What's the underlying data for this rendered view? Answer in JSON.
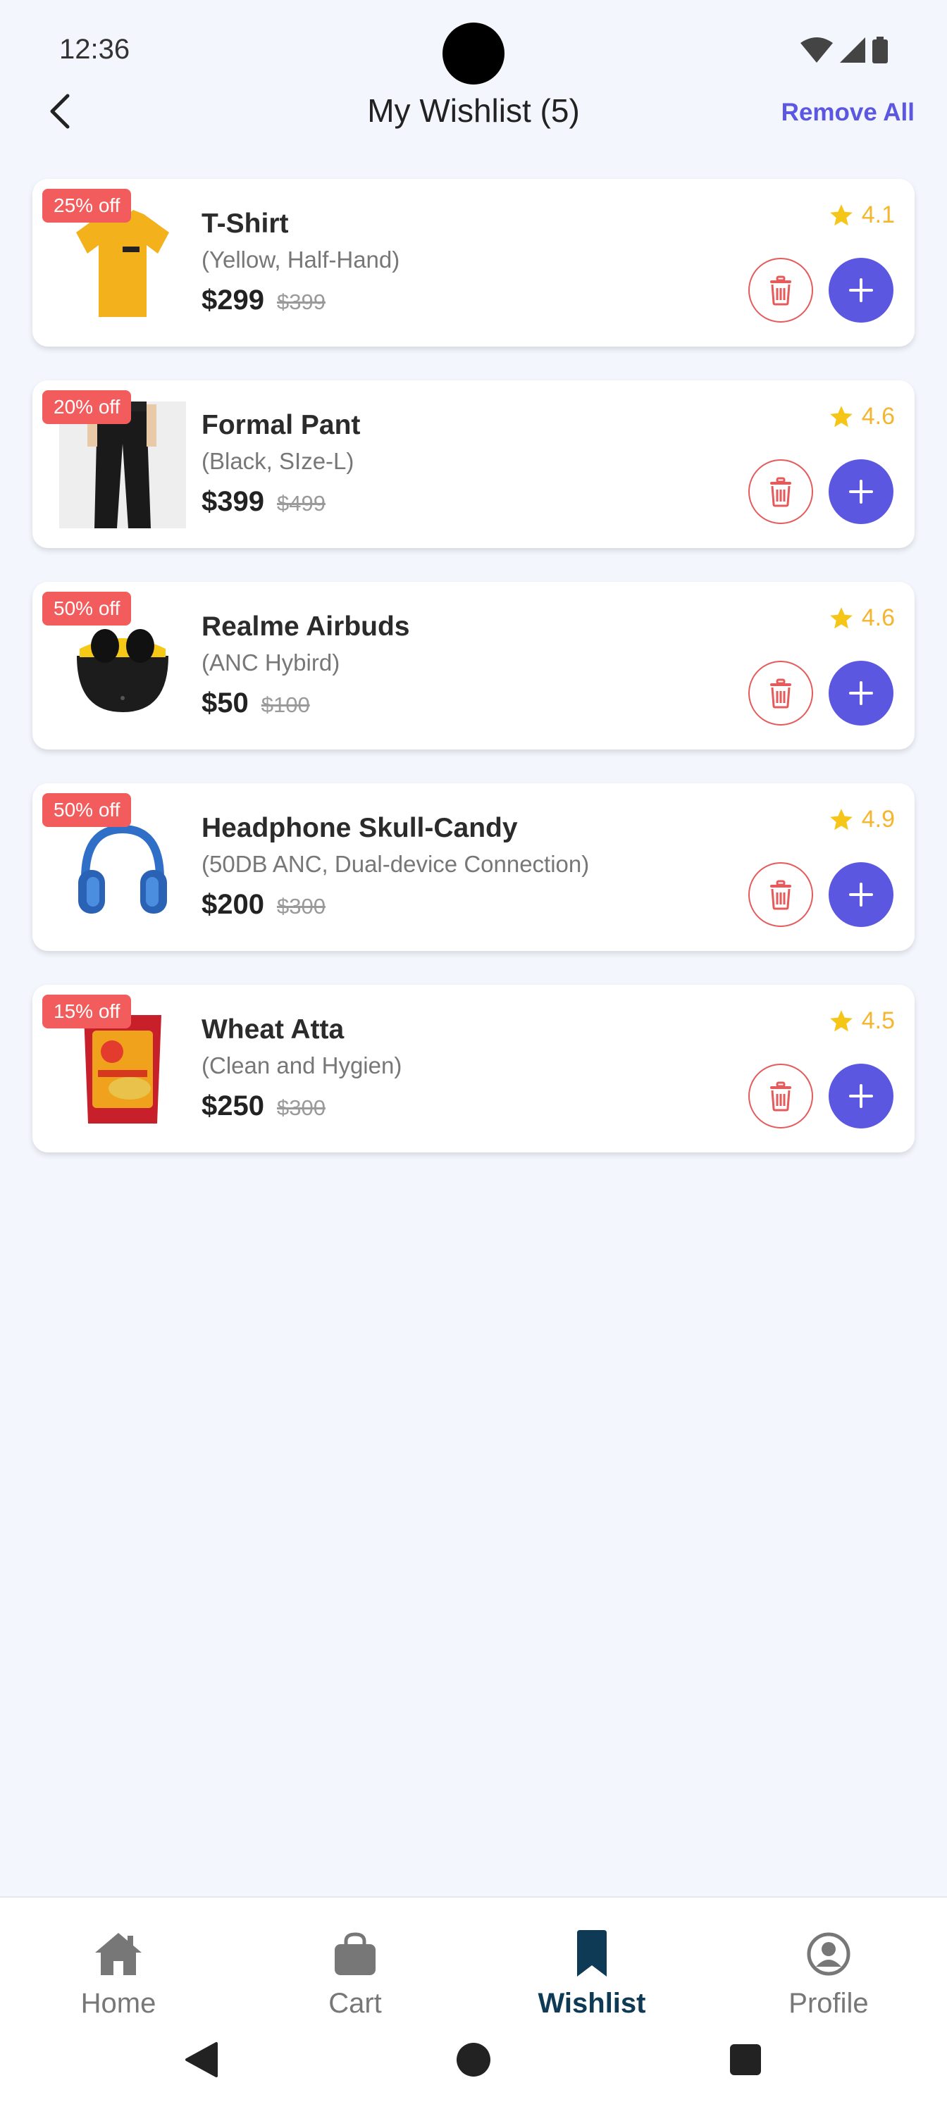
{
  "status_bar": {
    "time": "12:36"
  },
  "header": {
    "title": "My Wishlist (5)",
    "remove_all_label": "Remove All",
    "back_icon": "chevron-left-icon"
  },
  "items": [
    {
      "name": "T-Shirt",
      "variant": "(Yellow, Half-Hand)",
      "price": "$299",
      "old_price": "$399",
      "discount": "25% off",
      "rating": "4.1",
      "image": "yellow-tshirt"
    },
    {
      "name": "Formal Pant",
      "variant": "(Black, SIze-L)",
      "price": "$399",
      "old_price": "$499",
      "discount": "20% off",
      "rating": "4.6",
      "image": "black-pant"
    },
    {
      "name": "Realme Airbuds",
      "variant": "(ANC Hybird)",
      "price": "$50",
      "old_price": "$100",
      "discount": "50% off",
      "rating": "4.6",
      "image": "airbuds-case"
    },
    {
      "name": "Headphone Skull-Candy",
      "variant": "(50DB ANC, Dual-device Connection)",
      "price": "$200",
      "old_price": "$300",
      "discount": "50% off",
      "rating": "4.9",
      "image": "blue-headphones"
    },
    {
      "name": "Wheat Atta",
      "variant": "(Clean and Hygien)",
      "price": "$250",
      "old_price": "$300",
      "discount": "15% off",
      "rating": "4.5",
      "image": "atta-packet"
    }
  ],
  "bottom_nav": {
    "items": [
      {
        "label": "Home",
        "icon": "home-icon",
        "active": false
      },
      {
        "label": "Cart",
        "icon": "shopping-bag-icon",
        "active": false
      },
      {
        "label": "Wishlist",
        "icon": "bookmark-icon",
        "active": true
      },
      {
        "label": "Profile",
        "icon": "profile-icon",
        "active": false
      }
    ]
  },
  "colors": {
    "accent": "#5b57e0",
    "danger": "#e55a5a",
    "badge": "#f25c5c",
    "star": "#f5b52e",
    "nav_active": "#0f3a55",
    "background": "#f4f6fe"
  }
}
